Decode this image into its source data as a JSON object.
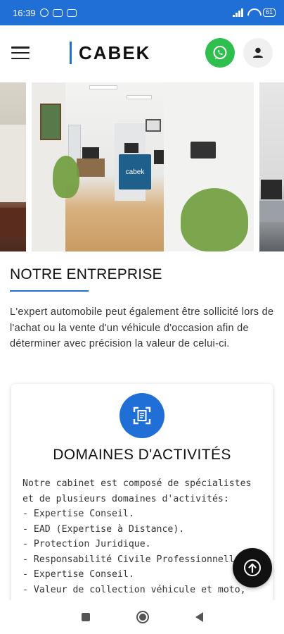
{
  "status_bar": {
    "time": "16:39",
    "battery": "61"
  },
  "header": {
    "logo": "CABEK",
    "menu_icon": "hamburger-menu-icon",
    "whatsapp_icon": "whatsapp-icon",
    "user_icon": "user-account-icon"
  },
  "gallery": {
    "panel_label": "cabek"
  },
  "section": {
    "title": "NOTRE ENTREPRISE",
    "text": "L'expert automobile peut également être sollicité lors de l'achat ou la vente d'un véhicule d'occasion afin de déterminer avec précision la valeur de celui-ci."
  },
  "card": {
    "icon": "document-scan-icon",
    "title": "DOMAINES D'ACTIVITÉS",
    "lines": [
      "Notre cabinet est composé de spécialistes",
      "et de plusieurs domaines d'activités:",
      "- Expertise Conseil.",
      "- EAD (Expertise à Distance).",
      "- Protection Juridique.",
      "- Responsabilité Civile Professionnelle.",
      "- Expertise Conseil.",
      "- Valeur de collection véhicule et moto,"
    ]
  },
  "fab": {
    "icon": "arrow-up-icon"
  },
  "colors": {
    "brand_blue": "#1f6fd6",
    "whatsapp_green": "#2fbf4e",
    "fab_black": "#111111"
  }
}
